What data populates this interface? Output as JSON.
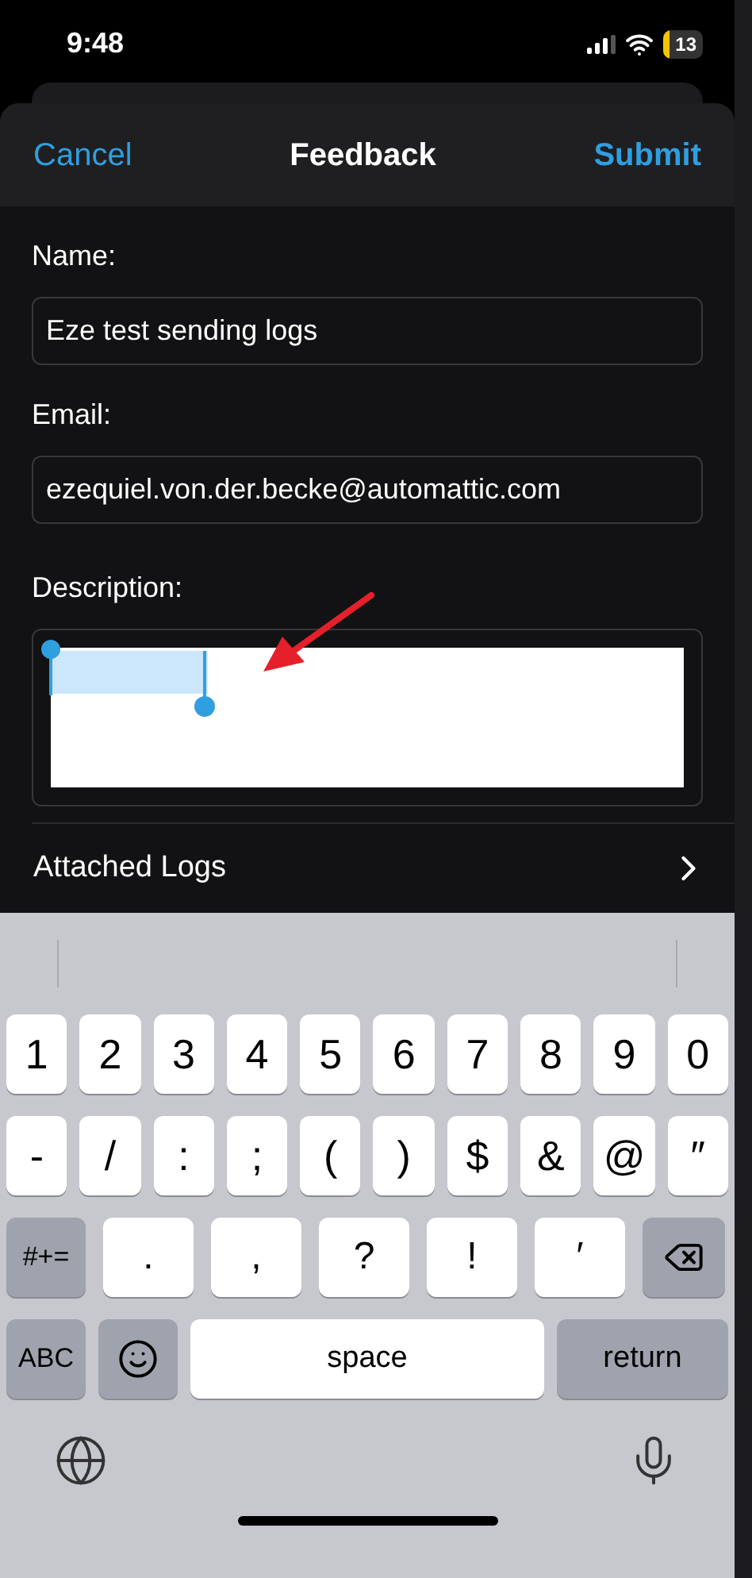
{
  "status_bar": {
    "time": "9:48",
    "battery": "13"
  },
  "nav": {
    "cancel": "Cancel",
    "title": "Feedback",
    "submit": "Submit"
  },
  "fields": [
    {
      "label": "Name:",
      "value": "Eze test sending logs"
    },
    {
      "label": "Email:",
      "value": "ezequiel.von.der.becke@automattic.com"
    }
  ],
  "description": {
    "label": "Description:"
  },
  "attached_logs": {
    "label": "Attached Logs"
  },
  "keyboard": {
    "number_row": [
      {
        "kind": "char",
        "label": "1"
      },
      {
        "kind": "char",
        "label": "2"
      },
      {
        "kind": "char",
        "label": "3"
      },
      {
        "kind": "char",
        "label": "4"
      },
      {
        "kind": "char",
        "label": "5"
      },
      {
        "kind": "char",
        "label": "6"
      },
      {
        "kind": "char",
        "label": "7"
      },
      {
        "kind": "char",
        "label": "8"
      },
      {
        "kind": "char",
        "label": "9"
      },
      {
        "kind": "char",
        "label": "0"
      }
    ],
    "symbol_row": [
      {
        "kind": "char",
        "label": "-"
      },
      {
        "kind": "char",
        "label": "/"
      },
      {
        "kind": "char",
        "label": ":"
      },
      {
        "kind": "char",
        "label": ";"
      },
      {
        "kind": "char",
        "label": "("
      },
      {
        "kind": "char",
        "label": ")"
      },
      {
        "kind": "char",
        "label": "$"
      },
      {
        "kind": "char",
        "label": "&"
      },
      {
        "kind": "char",
        "label": "@"
      },
      {
        "kind": "char",
        "label": "″"
      }
    ],
    "punctuation_row": [
      {
        "kind": "function",
        "label": "#+="
      },
      {
        "kind": "wide",
        "label": "."
      },
      {
        "kind": "wide",
        "label": ","
      },
      {
        "kind": "wide",
        "label": "?"
      },
      {
        "kind": "wide",
        "label": "!"
      },
      {
        "kind": "wide",
        "label": "′"
      },
      {
        "kind": "delete"
      }
    ],
    "bottom_row": [
      {
        "kind": "function",
        "label": "ABC"
      },
      {
        "kind": "emoji"
      },
      {
        "kind": "space",
        "label": "space"
      },
      {
        "kind": "return",
        "label": "return"
      }
    ]
  }
}
